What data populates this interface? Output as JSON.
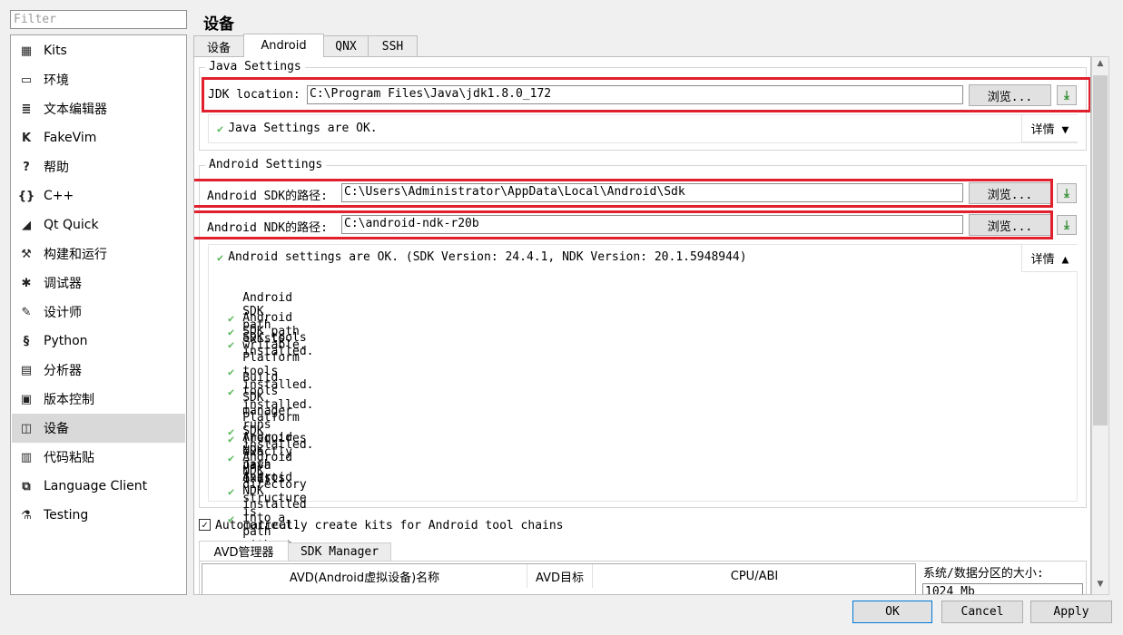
{
  "filter": {
    "placeholder": "Filter"
  },
  "sidebar": {
    "items": [
      {
        "label": "Kits",
        "icon": "▦"
      },
      {
        "label": "环境",
        "icon": "▭"
      },
      {
        "label": "文本编辑器",
        "icon": "≣"
      },
      {
        "label": "FakeVim",
        "icon": "K"
      },
      {
        "label": "帮助",
        "icon": "?"
      },
      {
        "label": "C++",
        "icon": "{}"
      },
      {
        "label": "Qt Quick",
        "icon": "◢"
      },
      {
        "label": "构建和运行",
        "icon": "⚒"
      },
      {
        "label": "调试器",
        "icon": "✱"
      },
      {
        "label": "设计师",
        "icon": "✎"
      },
      {
        "label": "Python",
        "icon": "§"
      },
      {
        "label": "分析器",
        "icon": "▤"
      },
      {
        "label": "版本控制",
        "icon": "▣"
      },
      {
        "label": "设备",
        "icon": "◫"
      },
      {
        "label": "代码粘贴",
        "icon": "▥"
      },
      {
        "label": "Language Client",
        "icon": "⧉"
      },
      {
        "label": "Testing",
        "icon": "⚗"
      }
    ],
    "selected": "设备"
  },
  "page": {
    "title": "设备"
  },
  "tabs": [
    "设备",
    "Android",
    "QNX",
    "SSH"
  ],
  "java": {
    "group_title": "Java Settings",
    "jdk_label": "JDK location:",
    "jdk_value": "C:\\Program Files\\Java\\jdk1.8.0_172",
    "browse_label": "浏览...",
    "status": "Java Settings are OK.",
    "details_label": "详情 ▼"
  },
  "android": {
    "group_title": "Android Settings",
    "sdk_label": "Android SDK的路径:",
    "sdk_value": "C:\\Users\\Administrator\\AppData\\Local\\Android\\Sdk",
    "ndk_label": "Android NDK的路径:",
    "ndk_value": "C:\\android-ndk-r20b",
    "browse_label": "浏览...",
    "status": "Android settings are OK. (SDK Version: 24.4.1, NDK Version: 20.1.5948944)",
    "details_label": "详情 ▲",
    "checks": [
      "Android SDK path exists.",
      "Android SDK path writable.",
      "SDK tools installed.",
      "Platform tools installed.",
      "Build tools installed.",
      "SDK manager runs (requires exactly Java 1.8).",
      "Platform SDK installed.",
      "Android NDK path exists.",
      "Android NDK directory structure is correct.",
      "Android NDK installed into a path without spaces."
    ]
  },
  "auto_kits": {
    "label": "Automatically create kits for Android tool chains",
    "checked": true
  },
  "avd": {
    "tabs": [
      "AVD管理器",
      "SDK Manager"
    ],
    "columns": [
      "AVD(Android虚拟设备)名称",
      "AVD目标",
      "CPU/ABI"
    ],
    "partition_label": "系统/数据分区的大小:",
    "partition_value": "1024 Mb"
  },
  "footer": {
    "ok": "OK",
    "cancel": "Cancel",
    "apply": "Apply"
  },
  "colors": {
    "highlight": "#e0202c",
    "check": "#5cb85c"
  }
}
